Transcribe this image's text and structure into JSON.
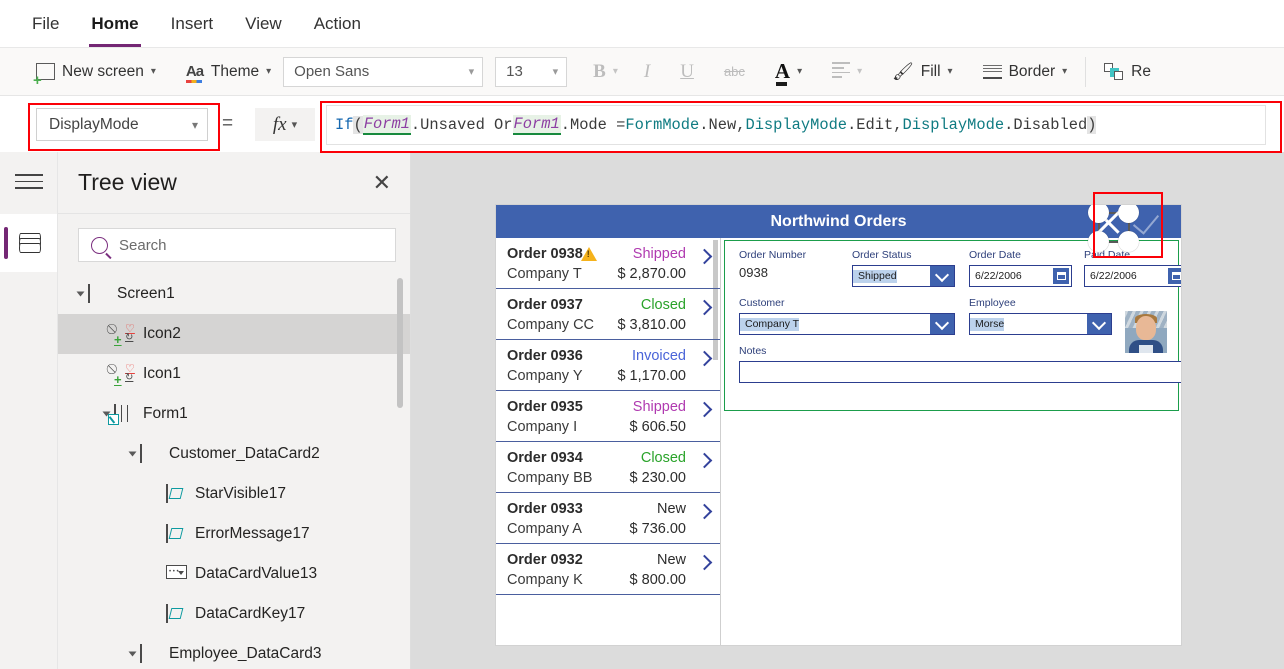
{
  "menubar": {
    "items": [
      {
        "label": "File",
        "active": false
      },
      {
        "label": "Home",
        "active": true
      },
      {
        "label": "Insert",
        "active": false
      },
      {
        "label": "View",
        "active": false
      },
      {
        "label": "Action",
        "active": false
      }
    ]
  },
  "toolbar": {
    "new_screen": "New screen",
    "theme": "Theme",
    "font_family": "Open Sans",
    "font_size": "13",
    "bold": "B",
    "italic": "I",
    "underline": "U",
    "strikethrough": "abc",
    "font_color": "A",
    "align": "align",
    "fill": "Fill",
    "border": "Border",
    "reorder": "Re"
  },
  "formula_bar": {
    "property": "DisplayMode",
    "equals": "=",
    "fx": "fx",
    "formula_tokens": [
      {
        "t": "If",
        "k": "fn"
      },
      {
        "t": "(",
        "k": "par"
      },
      {
        "t": " ",
        "k": "txt"
      },
      {
        "t": "Form1",
        "k": "ref"
      },
      {
        "t": ".Unsaved Or ",
        "k": "txt"
      },
      {
        "t": "Form1",
        "k": "ref"
      },
      {
        "t": ".Mode = ",
        "k": "txt"
      },
      {
        "t": "FormMode",
        "k": "en"
      },
      {
        "t": ".New, ",
        "k": "txt"
      },
      {
        "t": "DisplayMode",
        "k": "en"
      },
      {
        "t": ".Edit, ",
        "k": "txt"
      },
      {
        "t": "DisplayMode",
        "k": "en"
      },
      {
        "t": ".Disabled ",
        "k": "txt"
      },
      {
        "t": ")",
        "k": "par"
      }
    ],
    "formula_text": "If( Form1.Unsaved Or Form1.Mode = FormMode.New, DisplayMode.Edit, DisplayMode.Disabled )"
  },
  "tree_panel": {
    "title": "Tree view",
    "close": "✕",
    "search_placeholder": "Search",
    "search_value": "",
    "nodes": [
      {
        "label": "Screen1",
        "icon": "screen-icon",
        "depth": 0,
        "expandable": true,
        "selected": false
      },
      {
        "label": "Icon2",
        "icon": "control-icon",
        "depth": 1,
        "expandable": false,
        "selected": true
      },
      {
        "label": "Icon1",
        "icon": "control-icon",
        "depth": 1,
        "expandable": false,
        "selected": false
      },
      {
        "label": "Form1",
        "icon": "form-icon",
        "depth": 1,
        "expandable": true,
        "selected": false
      },
      {
        "label": "Customer_DataCard2",
        "icon": "datacard-icon",
        "depth": 2,
        "expandable": true,
        "selected": false
      },
      {
        "label": "StarVisible17",
        "icon": "label-icon",
        "depth": 3,
        "expandable": false,
        "selected": false
      },
      {
        "label": "ErrorMessage17",
        "icon": "label-icon",
        "depth": 3,
        "expandable": false,
        "selected": false
      },
      {
        "label": "DataCardValue13",
        "icon": "dropdown-icon",
        "depth": 3,
        "expandable": false,
        "selected": false
      },
      {
        "label": "DataCardKey17",
        "icon": "label-icon",
        "depth": 3,
        "expandable": false,
        "selected": false
      },
      {
        "label": "Employee_DataCard3",
        "icon": "datacard-icon",
        "depth": 2,
        "expandable": true,
        "selected": false
      }
    ]
  },
  "canvas": {
    "app_title": "Northwind Orders",
    "gallery": [
      {
        "order": "Order 0938",
        "company": "Company T",
        "status": "Shipped",
        "amount": "$ 2,870.00",
        "status_color": "#b03ab0",
        "warning": true
      },
      {
        "order": "Order 0937",
        "company": "Company CC",
        "status": "Closed",
        "amount": "$ 3,810.00",
        "status_color": "#2aa32a",
        "warning": false
      },
      {
        "order": "Order 0936",
        "company": "Company Y",
        "status": "Invoiced",
        "amount": "$ 1,170.00",
        "status_color": "#4a64d8",
        "warning": false
      },
      {
        "order": "Order 0935",
        "company": "Company I",
        "status": "Shipped",
        "amount": "$ 606.50",
        "status_color": "#b03ab0",
        "warning": false
      },
      {
        "order": "Order 0934",
        "company": "Company BB",
        "status": "Closed",
        "amount": "$ 230.00",
        "status_color": "#2aa32a",
        "warning": false
      },
      {
        "order": "Order 0933",
        "company": "Company A",
        "status": "New",
        "amount": "$ 736.00",
        "status_color": "#2c2c2c",
        "warning": false
      },
      {
        "order": "Order 0932",
        "company": "Company K",
        "status": "New",
        "amount": "$ 800.00",
        "status_color": "#2c2c2c",
        "warning": false
      }
    ],
    "form": {
      "order_number_label": "Order Number",
      "order_number_value": "0938",
      "order_status_label": "Order Status",
      "order_status_value": "Shipped",
      "order_date_label": "Order Date",
      "order_date_value": "6/22/2006",
      "paid_date_label": "Paid Date",
      "paid_date_value": "6/22/2006",
      "customer_label": "Customer",
      "customer_value": "Company T",
      "employee_label": "Employee",
      "employee_value": "Morse",
      "notes_label": "Notes",
      "notes_value": ""
    },
    "selection": {
      "cancel_icon": "cancel-x-icon",
      "check_icon": "check-icon"
    }
  },
  "annotations": {
    "property_box": "highlight-property-dropdown",
    "formula_box": "highlight-formula-bar",
    "icon_box": "highlight-selected-icon"
  },
  "colors": {
    "accent": "#742774",
    "app_header": "#3f62ae",
    "annotation": "#fb0007",
    "form_outline": "#1b9d4b"
  }
}
